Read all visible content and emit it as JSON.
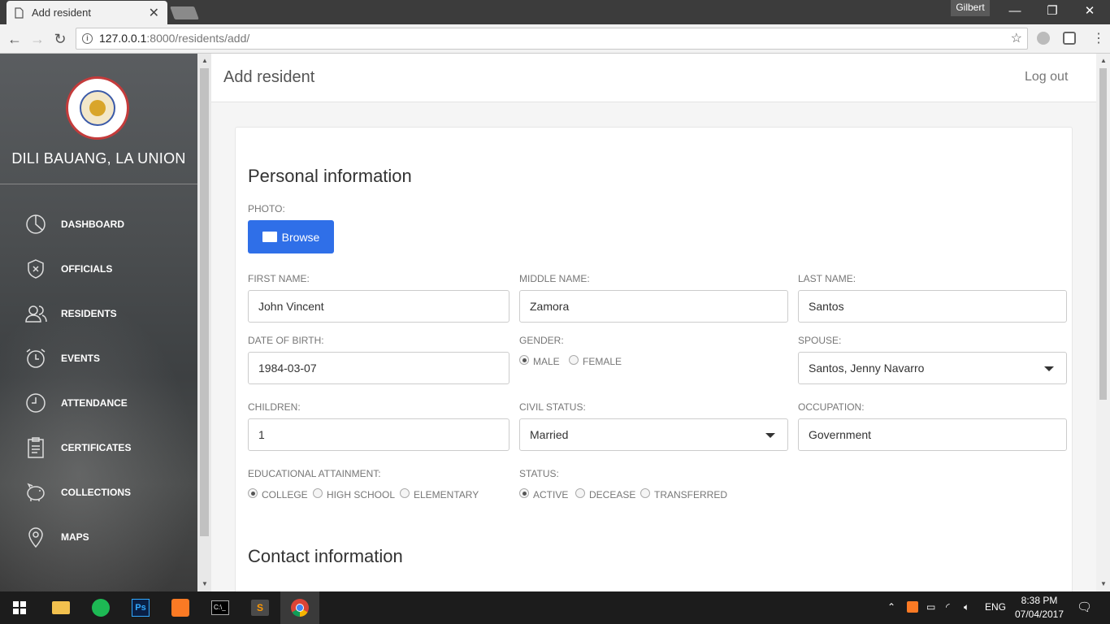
{
  "browser": {
    "tab_title": "Add resident",
    "user": "Gilbert",
    "url_host": "127.0.0.1",
    "url_path": ":8000/residents/add/"
  },
  "sidebar": {
    "brand": "DILI BAUANG, LA UNION",
    "items": [
      {
        "label": "DASHBOARD",
        "icon": "pie-chart-icon"
      },
      {
        "label": "OFFICIALS",
        "icon": "shield-icon"
      },
      {
        "label": "RESIDENTS",
        "icon": "users-icon"
      },
      {
        "label": "EVENTS",
        "icon": "alarm-clock-icon"
      },
      {
        "label": "ATTENDANCE",
        "icon": "clock-icon"
      },
      {
        "label": "CERTIFICATES",
        "icon": "clipboard-icon"
      },
      {
        "label": "COLLECTIONS",
        "icon": "piggy-bank-icon"
      },
      {
        "label": "MAPS",
        "icon": "map-pin-icon"
      }
    ]
  },
  "header": {
    "title": "Add resident",
    "logout": "Log out"
  },
  "form": {
    "section_personal": "Personal information",
    "photo_label": "PHOTO:",
    "browse_label": "Browse",
    "first_name_label": "FIRST NAME:",
    "first_name": "John Vincent",
    "middle_name_label": "MIDDLE NAME:",
    "middle_name": "Zamora",
    "last_name_label": "LAST NAME:",
    "last_name": "Santos",
    "dob_label": "DATE OF BIRTH:",
    "dob": "1984-03-07",
    "gender_label": "GENDER:",
    "gender_options": [
      "MALE",
      "FEMALE"
    ],
    "gender_selected": "MALE",
    "spouse_label": "SPOUSE:",
    "spouse": "Santos, Jenny Navarro",
    "children_label": "CHILDREN:",
    "children": "1",
    "civil_status_label": "CIVIL STATUS:",
    "civil_status": "Married",
    "occupation_label": "OCCUPATION:",
    "occupation": "Government",
    "education_label": "EDUCATIONAL ATTAINMENT:",
    "education_options": [
      "COLLEGE",
      "HIGH SCHOOL",
      "ELEMENTARY"
    ],
    "education_selected": "COLLEGE",
    "status_label": "STATUS:",
    "status_options": [
      "ACTIVE",
      "DECEASE",
      "TRANSFERRED"
    ],
    "status_selected": "ACTIVE",
    "section_contact": "Contact information"
  },
  "taskbar": {
    "language": "ENG",
    "time": "8:38 PM",
    "date": "07/04/2017"
  },
  "colors": {
    "accent": "#2f6fe8",
    "sidebar": "#4b4e50"
  }
}
